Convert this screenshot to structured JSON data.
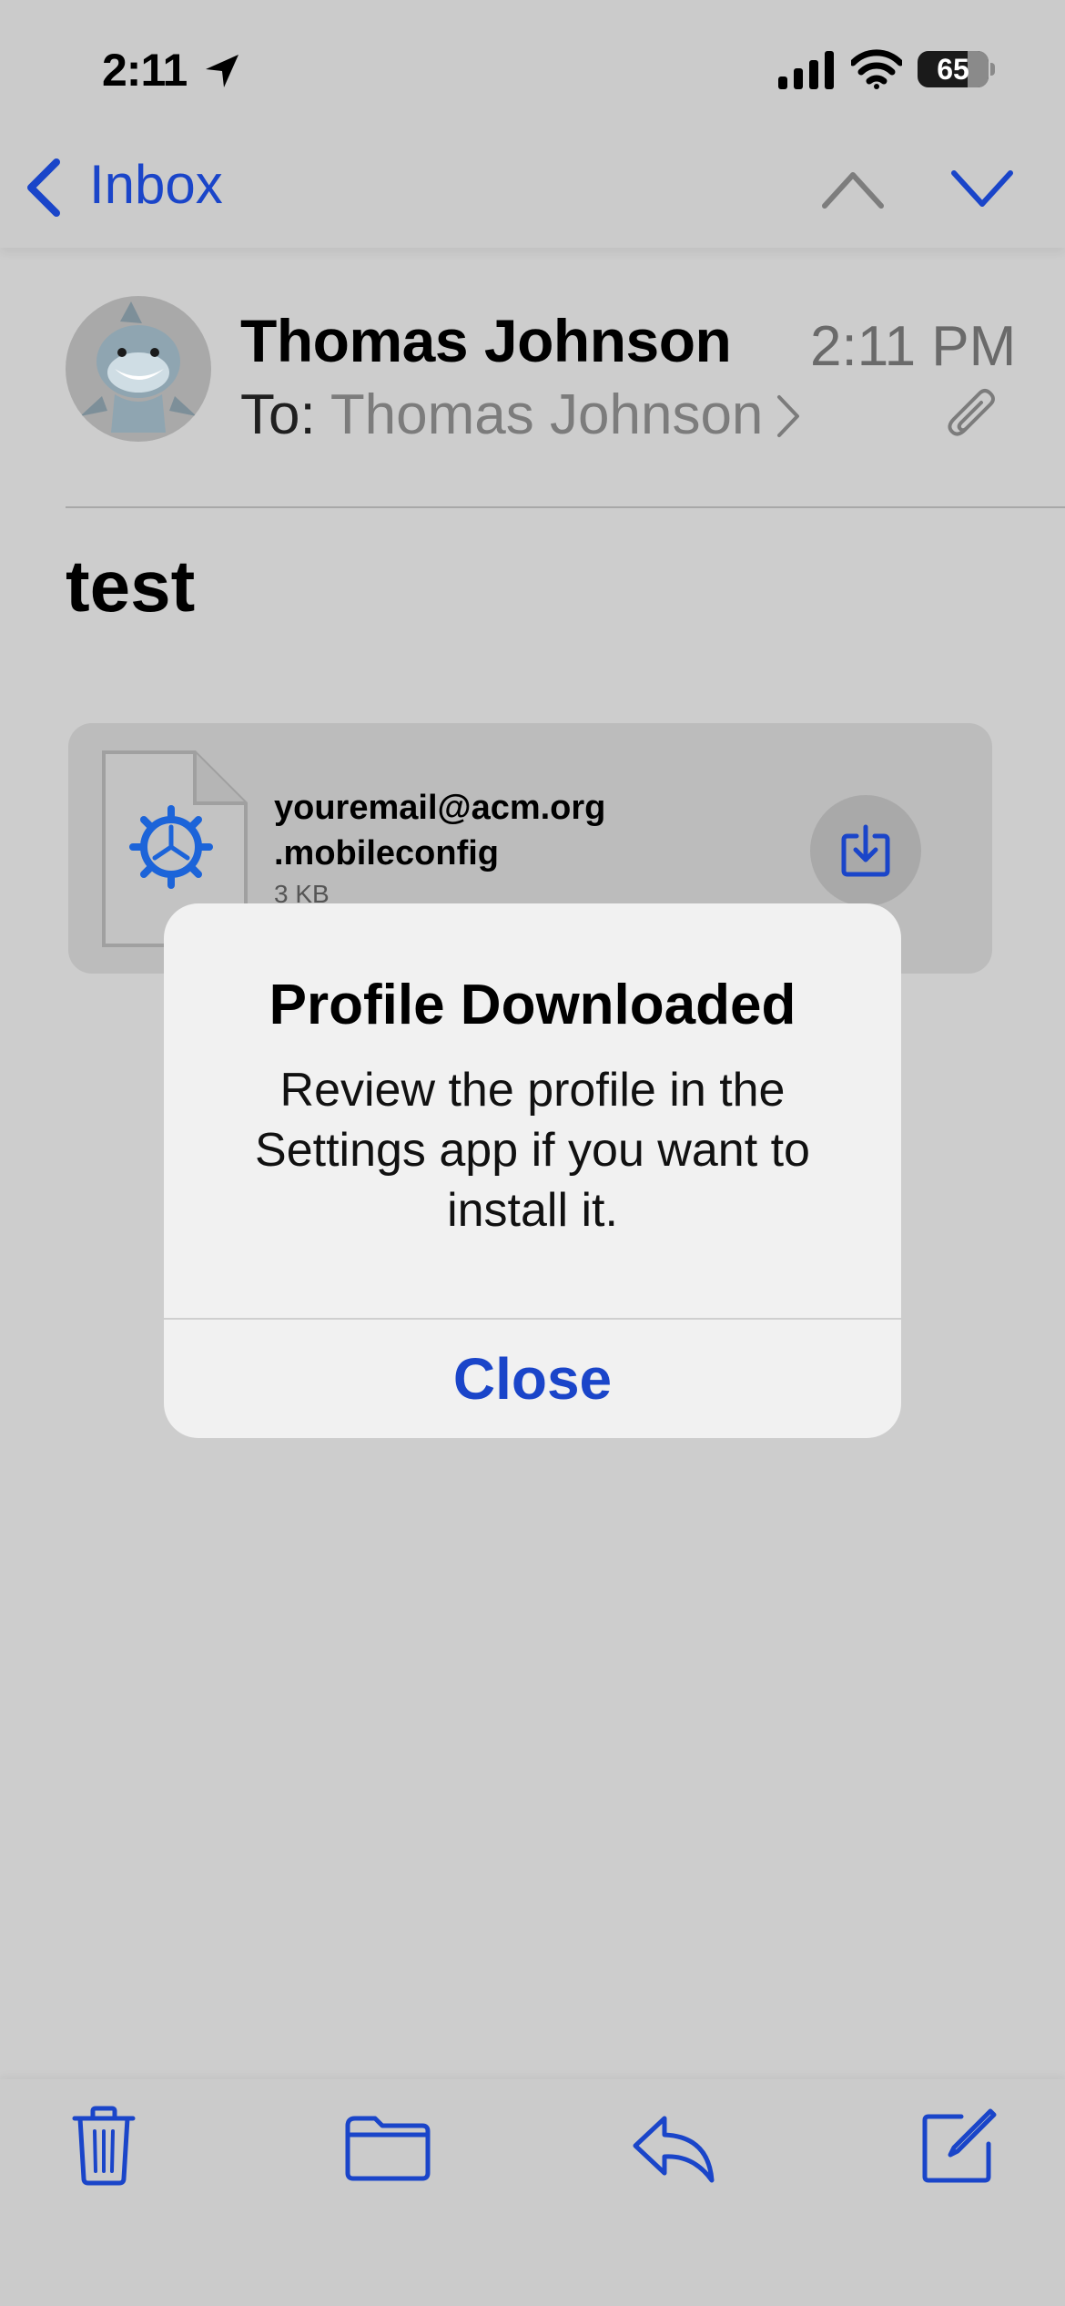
{
  "status_bar": {
    "time": "2:11",
    "battery": "65"
  },
  "nav": {
    "back_label": "Inbox"
  },
  "email": {
    "sender": "Thomas Johnson",
    "time": "2:11 PM",
    "to_prefix": "To: ",
    "recipient": "Thomas Johnson",
    "subject": "test"
  },
  "attachment": {
    "name_line1": "youremail@acm.org",
    "name_line2": ".mobileconfig",
    "size": "3 KB"
  },
  "alert": {
    "title": "Profile Downloaded",
    "message": "Review the profile in the Settings app if you want to install it.",
    "button": "Close"
  },
  "colors": {
    "accent": "#1a45c9",
    "background": "#cdcdcd",
    "alert_bg": "#f1f1f1"
  }
}
